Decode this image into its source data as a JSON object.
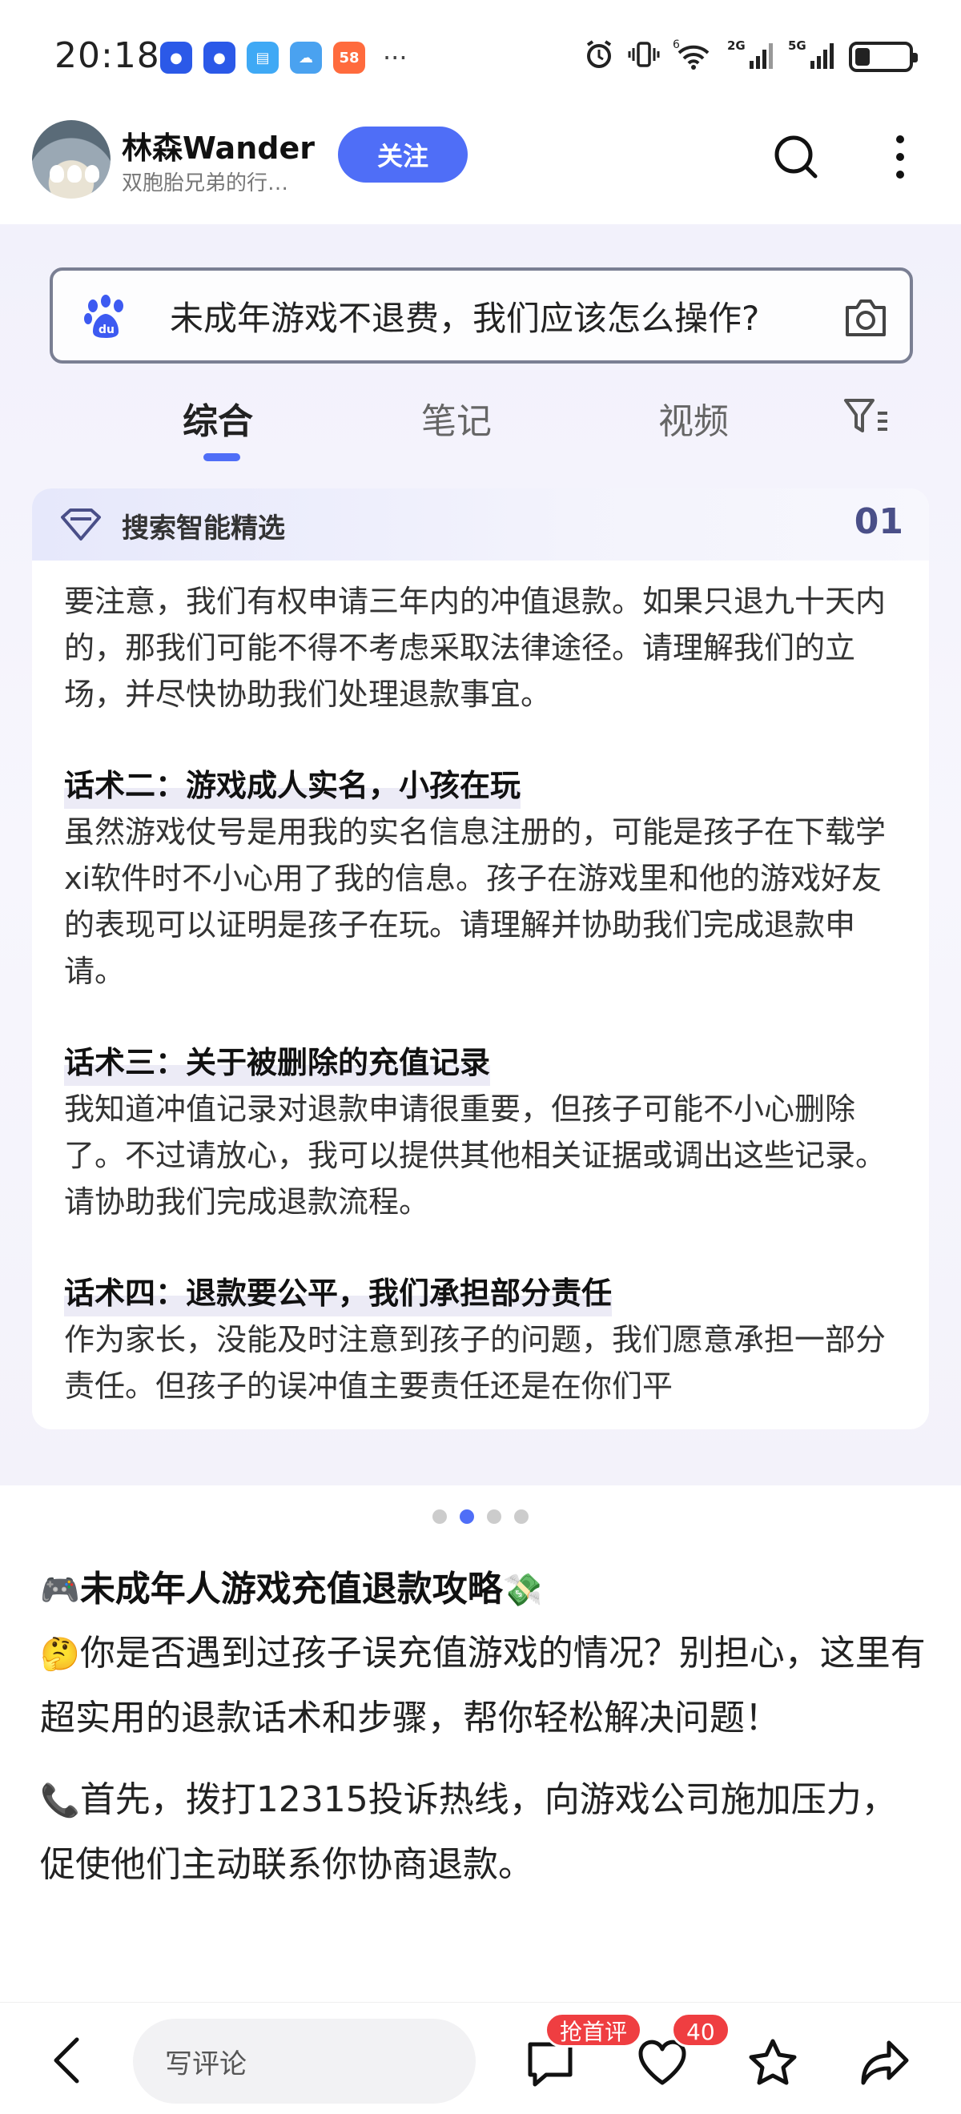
{
  "status_bar": {
    "time": "20:18",
    "apps": [
      {
        "name": "baidu-app-1",
        "color": "#2b59e8",
        "glyph": "●"
      },
      {
        "name": "baidu-app-2",
        "color": "#2b59e8",
        "glyph": "●"
      },
      {
        "name": "books-app",
        "color": "#3fa9f5",
        "glyph": "▤"
      },
      {
        "name": "weather-app",
        "color": "#4aa2f0",
        "glyph": "☁"
      },
      {
        "name": "58-app",
        "color": "#ff6b3d",
        "glyph": "58"
      }
    ],
    "more": "···",
    "signal_2g": "2G",
    "signal_5g": "5G",
    "signal_6": "6",
    "battery_level": 0.25
  },
  "header": {
    "author_name": "林森Wander",
    "author_desc": "双胞胎兄弟的行…",
    "follow_label": "关注"
  },
  "carousel": {
    "search_query": "未成年游戏不退费，我们应该怎么操作?",
    "tabs": [
      "综合",
      "笔记",
      "视频"
    ],
    "active_tab": "综合",
    "card_title": "搜索智能精选",
    "card_page": "01",
    "paragraphs": [
      {
        "heading": "",
        "text": "要注意，我们有权申请三年内的冲值退款。如果只退九十天内的，那我们可能不得不考虑采取法律途径。请理解我们的立场，并尽快协助我们处理退款事宜。"
      },
      {
        "heading": "话术二：游戏成人实名，小孩在玩",
        "text": "虽然游戏仗号是用我的实名信息注册的，可能是孩子在下载学xi软件时不小心用了我的信息。孩子在游戏里和他的游戏好友的表现可以证明是孩子在玩。请理解并协助我们完成退款申请。"
      },
      {
        "heading": "话术三：关于被删除的充值记录",
        "text": "我知道冲值记录对退款申请很重要，但孩子可能不小心删除了。不过请放心，我可以提供其他相关证据或调出这些记录。请协助我们完成退款流程。"
      },
      {
        "heading": "话术四：退款要公平，我们承担部分责任",
        "text": "作为家长，没能及时注意到孩子的问题，我们愿意承担一部分责任。但孩子的误冲值主要责任还是在你们平"
      }
    ],
    "page_count": 4,
    "active_page": 2
  },
  "post": {
    "title_emoji_left": "🎮",
    "title": "未成年人游戏充值退款攻略",
    "title_emoji_right": "💸",
    "para1_emoji": "🤔",
    "para1": "你是否遇到过孩子误充值游戏的情况？别担心，这里有超实用的退款话术和步骤，帮你轻松解决问题！",
    "para2_emoji": "📞",
    "para2": "首先，拨打12315投诉热线，向游戏公司施加压力，促使他们主动联系你协商退款。"
  },
  "bottom_bar": {
    "comment_placeholder": "写评论",
    "first_comment_badge": "抢首评",
    "like_count": "40"
  },
  "colors": {
    "accent": "#4f6ef7",
    "badge_red": "#ef3e41"
  }
}
